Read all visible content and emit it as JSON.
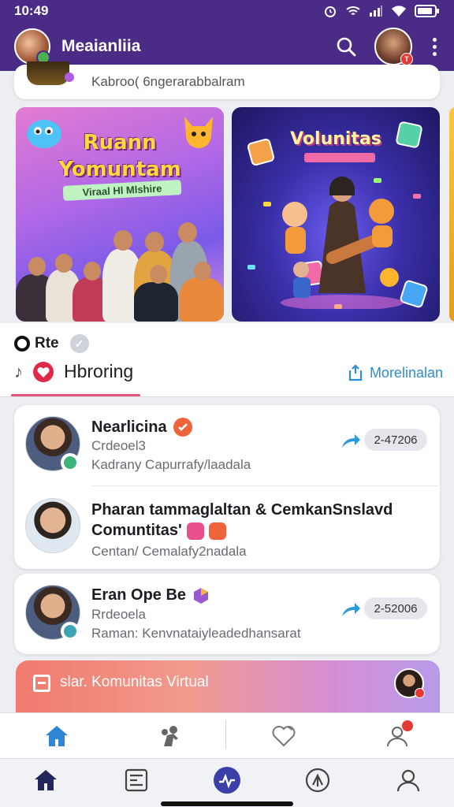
{
  "status_bar": {
    "time": "10:49"
  },
  "app_bar": {
    "title": "Meaianliia",
    "user_badge": "T"
  },
  "prev_item": {
    "text": "Kabroo( 6ngerarabbalram"
  },
  "banners": [
    {
      "title_line1": "Ruann",
      "title_line2": "Yomuntam",
      "subtitle": "Viraal Hl Mlshire"
    },
    {
      "title": "Volunitas"
    }
  ],
  "section": {
    "label": "Rte",
    "title": "Hbroring",
    "more": "Morelinalan"
  },
  "feed": [
    {
      "name": "Nearlicina",
      "sub": "Crdeoel3",
      "meta": "Kadrany Capurrafy/laadala",
      "count": "2-47206"
    },
    {
      "name": "Pharan tammaglaltan & CemkanSnslavd",
      "name2": "Comuntitas'",
      "meta": "Centan/ Cemalafy2nadala"
    },
    {
      "name": "Eran Ope Be",
      "sub": "Rrdeoela",
      "meta": "Raman: Kenvnataiyleadedhansarat",
      "count": "2-52006"
    }
  ],
  "promo": {
    "text": "slar. Komunitas Virtual"
  },
  "colors": {
    "header": "#4a2c86",
    "accent": "#2a8fd6",
    "badge": "#e53935",
    "nav_active": "#3b3fa8"
  },
  "nav_top": [
    "home-icon",
    "people-icon",
    "heart-icon",
    "profile-icon"
  ],
  "nav_bottom": [
    "home-icon",
    "feed-icon",
    "activity-icon",
    "community-icon",
    "account-icon"
  ]
}
